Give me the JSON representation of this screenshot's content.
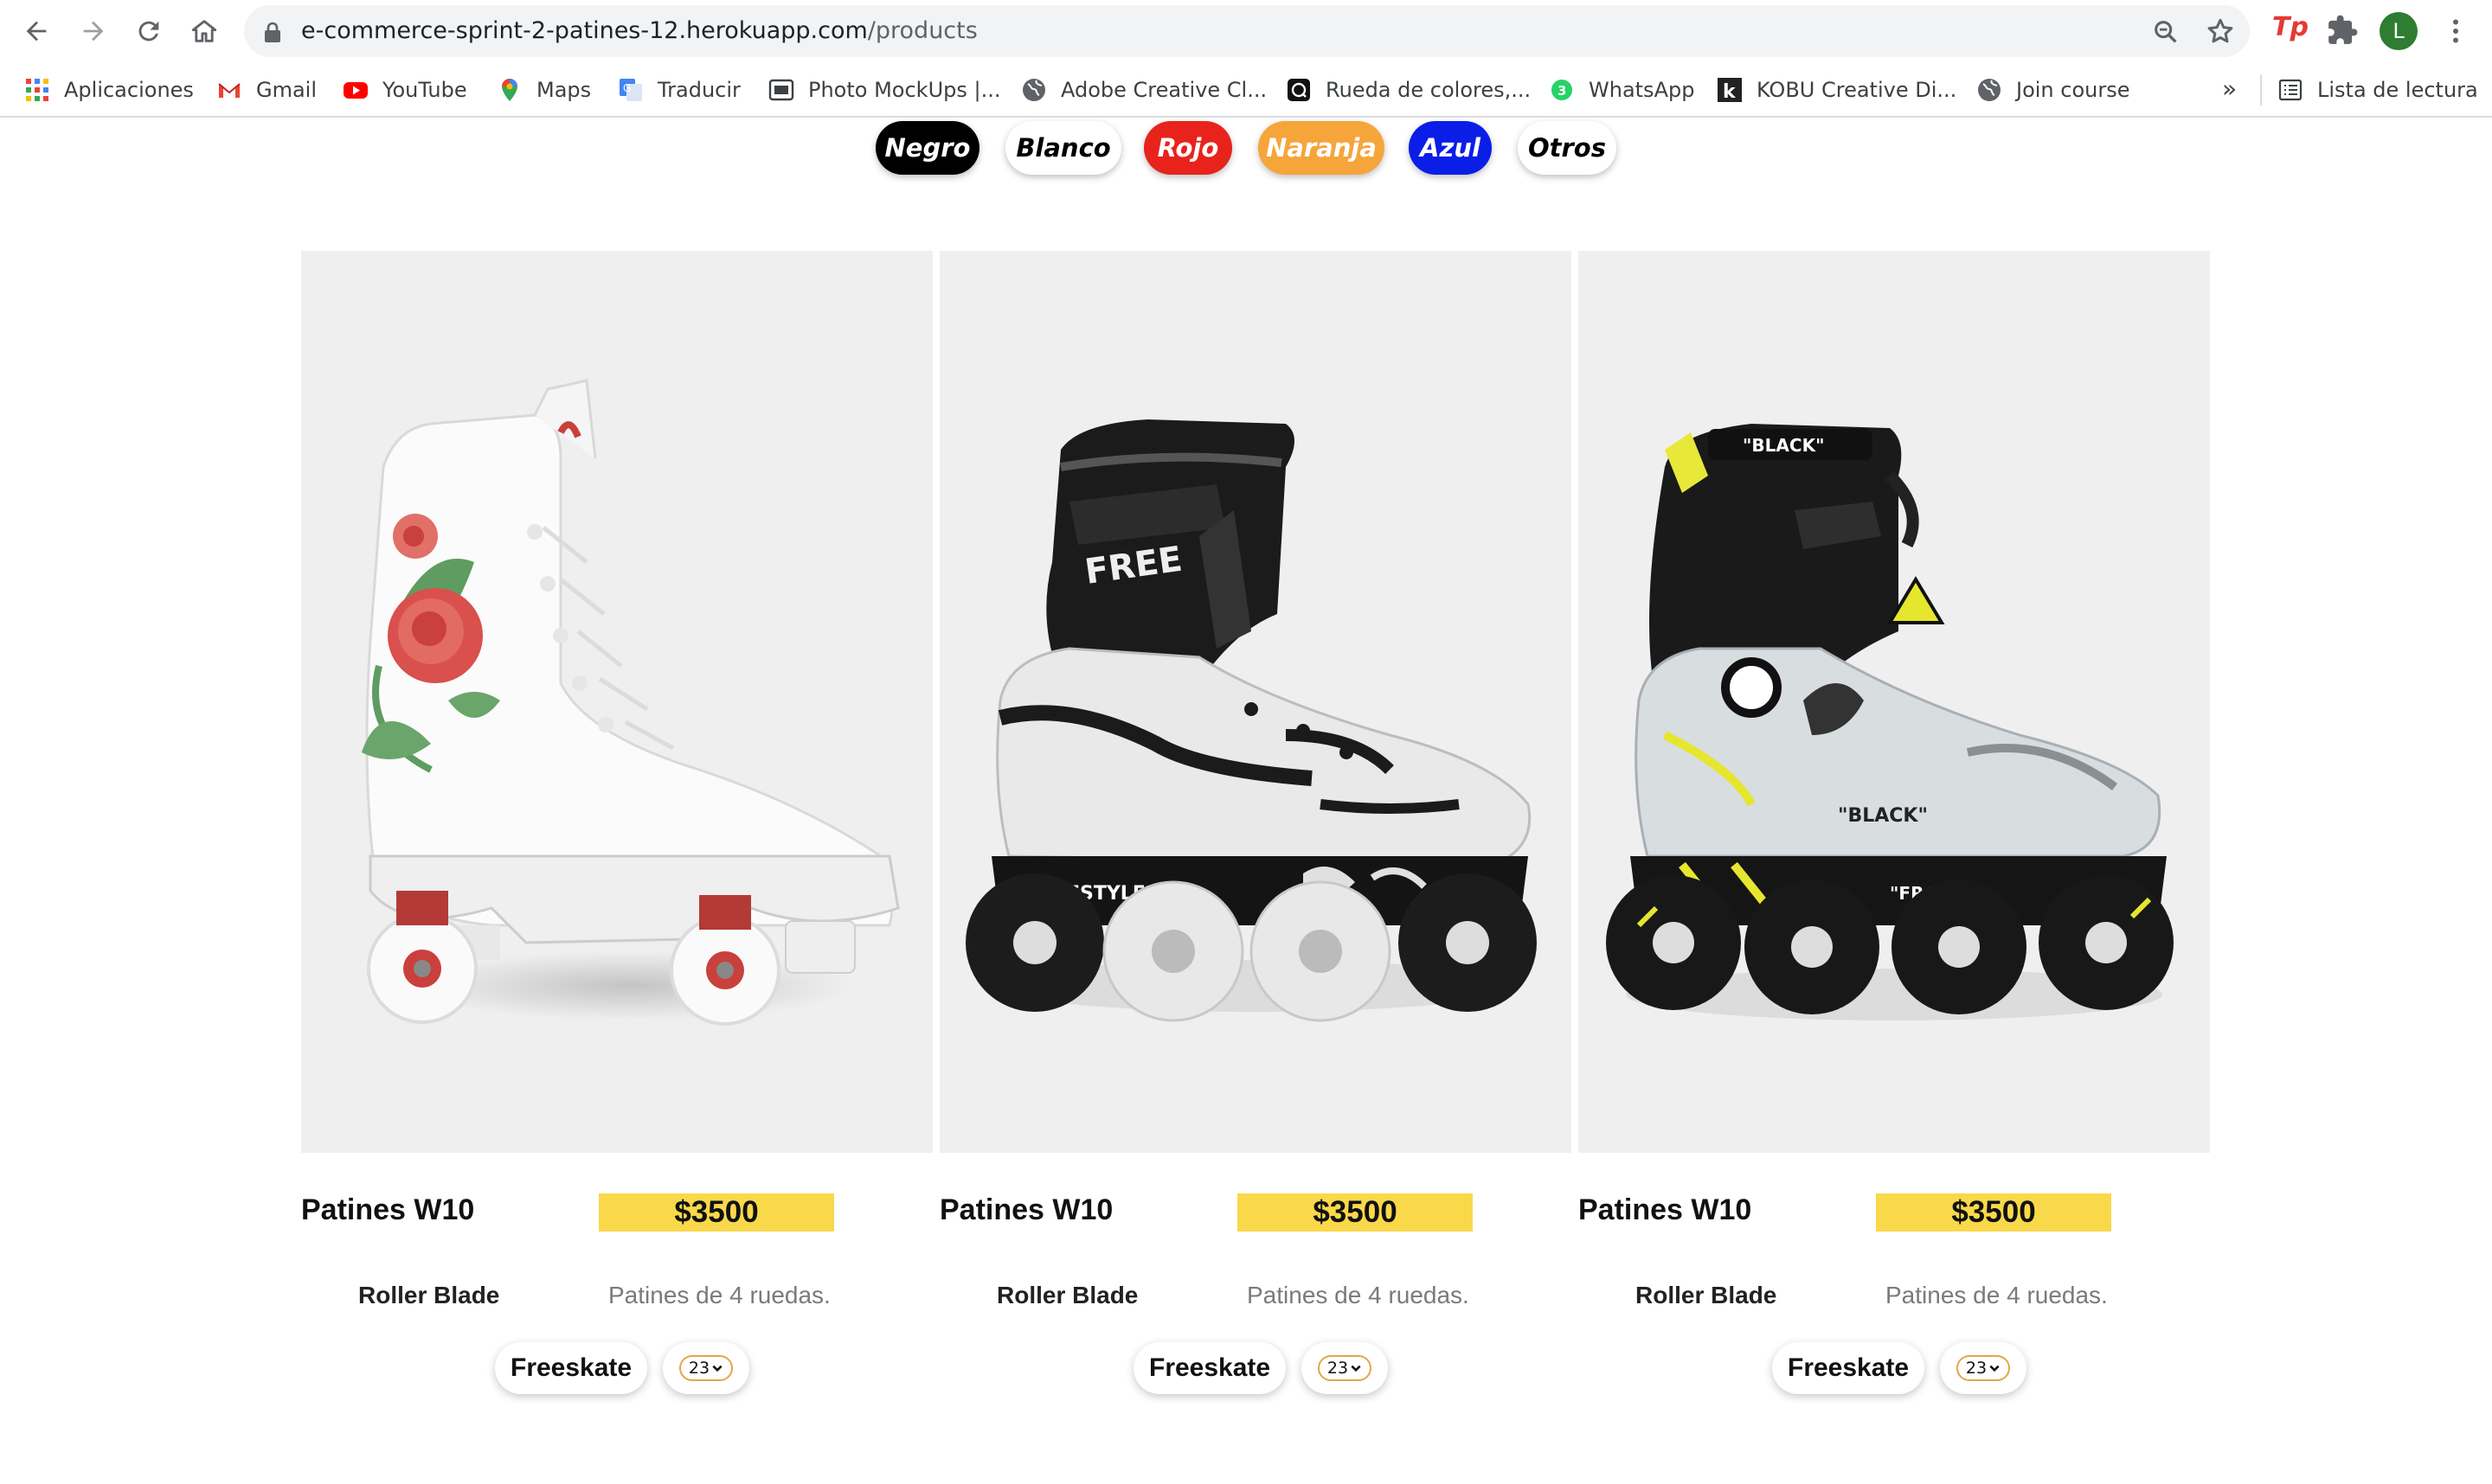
{
  "browser": {
    "url_host": "e-commerce-sprint-2-patines-12.herokuapp.com",
    "url_path": "/products",
    "avatar_letter": "L",
    "extension_label": "Tp"
  },
  "bookmarks": {
    "items": [
      {
        "label": "Aplicaciones",
        "icon": "apps-grid-icon"
      },
      {
        "label": "Gmail",
        "icon": "gmail-icon"
      },
      {
        "label": "YouTube",
        "icon": "youtube-icon"
      },
      {
        "label": "Maps",
        "icon": "maps-icon"
      },
      {
        "label": "Traducir",
        "icon": "translate-icon"
      },
      {
        "label": "Photo MockUps |...",
        "icon": "photo-mockups-icon"
      },
      {
        "label": "Adobe Creative Cl...",
        "icon": "globe-icon"
      },
      {
        "label": "Rueda de colores,...",
        "icon": "color-wheel-icon"
      },
      {
        "label": "WhatsApp",
        "icon": "whatsapp-icon"
      },
      {
        "label": "KOBU Creative Di...",
        "icon": "kobu-icon"
      },
      {
        "label": "Join course",
        "icon": "globe-icon"
      }
    ],
    "overflow": "»",
    "reading_list": "Lista de lectura"
  },
  "filters": [
    {
      "label": "Negro",
      "bg": "#000000",
      "fg": "#ffffff"
    },
    {
      "label": "Blanco",
      "bg": "#ffffff",
      "fg": "#000000"
    },
    {
      "label": "Rojo",
      "bg": "#e8231c",
      "fg": "#ffffff"
    },
    {
      "label": "Naranja",
      "bg": "#f5a53a",
      "fg": "#ffffff"
    },
    {
      "label": "Azul",
      "bg": "#0a1ee8",
      "fg": "#ffffff"
    },
    {
      "label": "Otros",
      "bg": "#ffffff",
      "fg": "#000000"
    }
  ],
  "products": [
    {
      "name": "Patines W10",
      "price": "$3500",
      "brand": "Roller Blade",
      "desc": "Patines de 4 ruedas.",
      "type": "Freeskate",
      "size": "23",
      "image": "white-quad-roller-skate-with-roses"
    },
    {
      "name": "Patines W10",
      "price": "$3500",
      "brand": "Roller Blade",
      "desc": "Patines de 4 ruedas.",
      "type": "Freeskate",
      "size": "23",
      "image": "black-white-freestyle-inline-skate"
    },
    {
      "name": "Patines W10",
      "price": "$3500",
      "brand": "Roller Blade",
      "desc": "Patines de 4 ruedas.",
      "type": "Freeskate",
      "size": "23",
      "image": "black-yellow-inline-skate"
    }
  ],
  "colors": {
    "price_bg": "#f9d84a",
    "photo_bg": "#efefef"
  }
}
